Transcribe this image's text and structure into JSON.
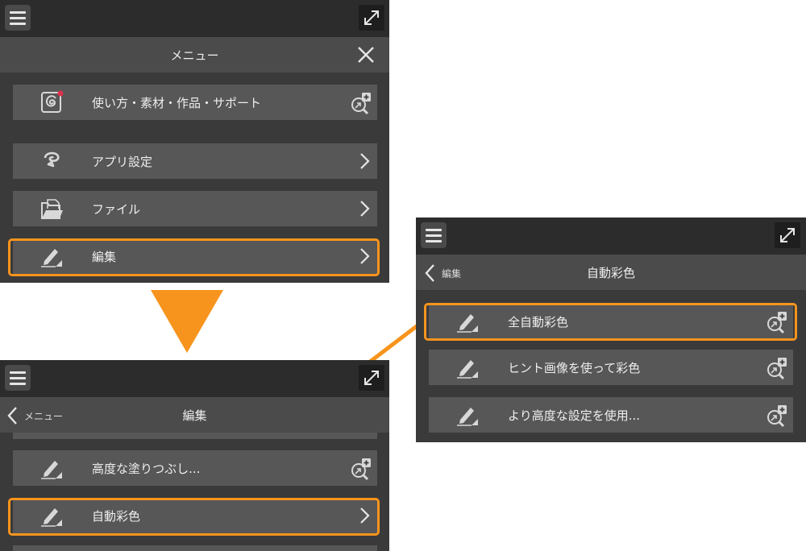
{
  "panel_a": {
    "title": "メニュー",
    "items": [
      {
        "label": "使い方・素材・作品・サポート"
      },
      {
        "label": "アプリ設定"
      },
      {
        "label": "ファイル"
      },
      {
        "label": "編集"
      }
    ]
  },
  "panel_b": {
    "back_label": "メニュー",
    "title": "編集",
    "items": [
      {
        "label": "高度な塗りつぶし..."
      },
      {
        "label": "自動彩色"
      }
    ]
  },
  "panel_c": {
    "back_label": "編集",
    "title": "自動彩色",
    "items": [
      {
        "label": "全自動彩色"
      },
      {
        "label": "ヒント画像を使って彩色"
      },
      {
        "label": "より高度な設定を使用..."
      }
    ]
  },
  "colors": {
    "highlight": "#f7941d",
    "panel": "#3a3a3a",
    "item": "#575757"
  },
  "icons": [
    "menu-icon",
    "expand-icon",
    "close-icon",
    "help-icon",
    "app-settings-icon",
    "file-icon",
    "pen-icon",
    "chevron-right-icon",
    "zoom-plus-icon",
    "back-chevron-icon"
  ]
}
